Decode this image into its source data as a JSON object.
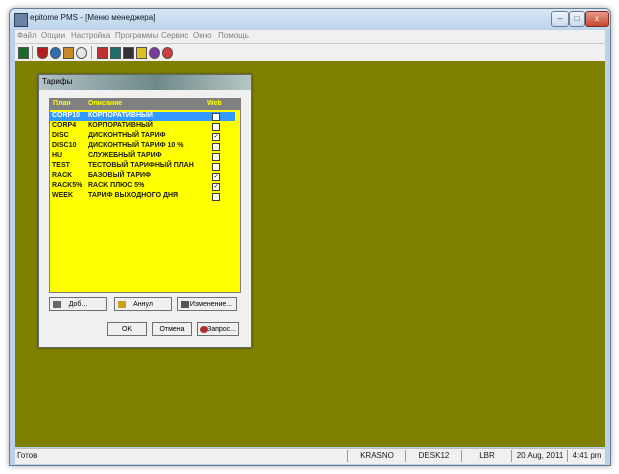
{
  "window": {
    "title": "epitome PMS - [Меню менеджера]",
    "minimize": "–",
    "maximize": "□",
    "close": "x"
  },
  "menu": [
    "Файл",
    "Опции",
    "Настройка",
    "Программы",
    "Сервис",
    "Окно",
    "Помощь"
  ],
  "toolbar_icons": [
    "exit-icon",
    "shield-icon",
    "globe-icon",
    "network-icon",
    "sun-icon",
    "grid-icon",
    "phone-icon",
    "bell-icon",
    "lightning-icon",
    "spiral-icon",
    "plus-target-icon"
  ],
  "dialog": {
    "title": "Тарифы",
    "columns": {
      "plan": "План",
      "description": "Описание",
      "web": "Web"
    },
    "rows": [
      {
        "plan": "CORP10",
        "description": "КОРПОРАТИВНЫЙ",
        "web": false,
        "selected": true
      },
      {
        "plan": "CORP4",
        "description": "КОРПОРАТИВНЫЙ",
        "web": false,
        "selected": false
      },
      {
        "plan": "DISC",
        "description": "ДИСКОНТНЫЙ ТАРИФ",
        "web": true,
        "selected": false
      },
      {
        "plan": "DISC10",
        "description": "ДИСКОНТНЫЙ ТАРИФ 10 %",
        "web": false,
        "selected": false
      },
      {
        "plan": "HU",
        "description": "СЛУЖЕБНЫЙ ТАРИФ",
        "web": false,
        "selected": false
      },
      {
        "plan": "TEST",
        "description": "ТЕСТОВЫЙ ТАРИФНЫЙ ПЛАН",
        "web": false,
        "selected": false
      },
      {
        "plan": "RACK",
        "description": "БАЗОВЫЙ ТАРИФ",
        "web": true,
        "selected": false
      },
      {
        "plan": "RACK5%",
        "description": "RACK ПЛЮС 5%",
        "web": true,
        "selected": false
      },
      {
        "plan": "WEEK",
        "description": "ТАРИФ ВЫХОДНОГО ДНЯ",
        "web": false,
        "selected": false
      }
    ],
    "buttons": {
      "add": "Доб...",
      "cancel_rate": "Аннул",
      "change": "Изменение...",
      "ok": "OK",
      "cancel": "Отмена",
      "query": "Запрос..."
    }
  },
  "status": {
    "text": "Готов",
    "user": "KRASNO",
    "desk": "DESK12",
    "code": "LBR",
    "date": "20 Aug, 2011",
    "time": "4:41 pm"
  },
  "colors": {
    "desktop": "#808000",
    "list_bg": "#ffff00",
    "selection": "#3399ff",
    "header_text": "#ffff00"
  }
}
